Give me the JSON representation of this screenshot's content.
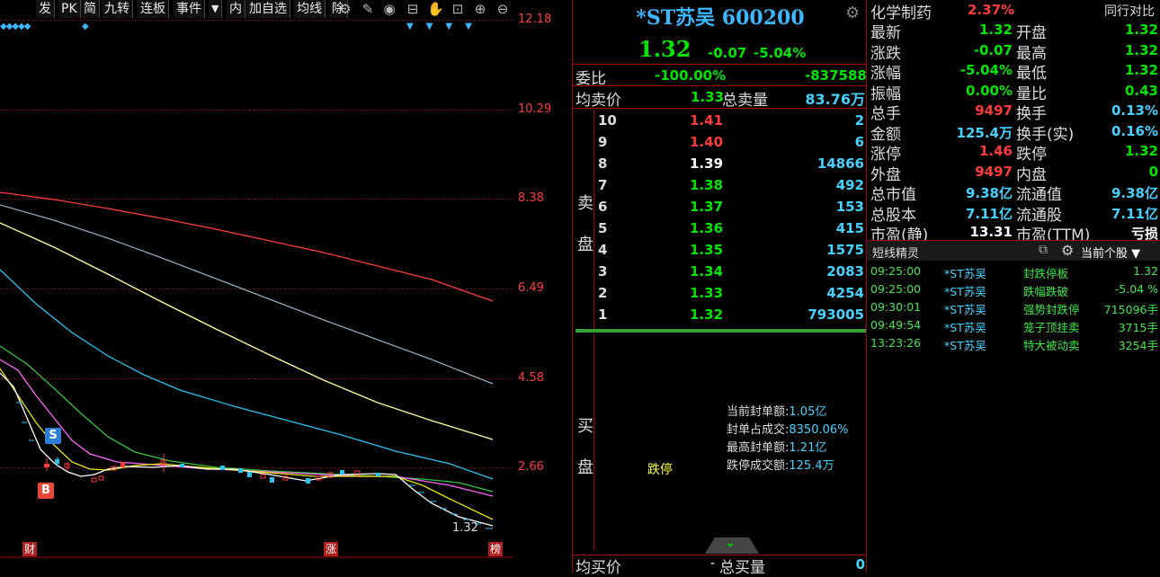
{
  "toolbar": {
    "items": [
      "发",
      "PK",
      "简",
      "九转",
      "连板",
      "事件",
      "▼",
      "内",
      "加自选",
      "均线",
      "除权"
    ]
  },
  "chart": {
    "y_axis": [
      "12.18",
      "10.29",
      "8.38",
      "6.49",
      "4.58",
      "2.66"
    ],
    "last_price_tag": "1.32",
    "markers": {
      "s": "S",
      "b": "B",
      "cai": "财",
      "zhang": "涨",
      "bang": "榜"
    },
    "colors": {
      "ma1": "#ff3b3b",
      "ma2": "#8fa6b8",
      "ma3": "#ffffa0",
      "ma4": "#27c4f0",
      "ma5": "#33c43f",
      "ma6": "#ff66ff",
      "ma7": "#ffffff",
      "ma8": "#e8e800"
    }
  },
  "quote": {
    "name": "*ST苏吴",
    "code": "600200",
    "price": "1.32",
    "change": "-0.07",
    "change_pct": "-5.04%",
    "weibi_label": "委比",
    "weibi_pct": "-100.00%",
    "weibi_diff": "-837588",
    "avg_sell_label": "均卖价",
    "avg_sell": "1.33",
    "total_sell_label": "总卖量",
    "total_sell": "83.76万",
    "sell_side_label": [
      "卖",
      "盘"
    ],
    "sells": [
      {
        "lvl": "10",
        "price": "1.41",
        "vol": "2"
      },
      {
        "lvl": "9",
        "price": "1.40",
        "vol": "6"
      },
      {
        "lvl": "8",
        "price": "1.39",
        "vol": "14866"
      },
      {
        "lvl": "7",
        "price": "1.38",
        "vol": "492"
      },
      {
        "lvl": "6",
        "price": "1.37",
        "vol": "153"
      },
      {
        "lvl": "5",
        "price": "1.36",
        "vol": "415"
      },
      {
        "lvl": "4",
        "price": "1.35",
        "vol": "1575"
      },
      {
        "lvl": "3",
        "price": "1.34",
        "vol": "2083"
      },
      {
        "lvl": "2",
        "price": "1.33",
        "vol": "4254"
      },
      {
        "lvl": "1",
        "price": "1.32",
        "vol": "793005"
      }
    ],
    "buy_side_label": [
      "买",
      "盘"
    ],
    "limit_down_text": "跌停",
    "seal": {
      "current_label": "当前封单额:",
      "current": "1.05亿",
      "ratio_label": "封单占成交:",
      "ratio": "8350.06%",
      "max_label": "最高封单额:",
      "max": "1.21亿",
      "limit_turnover_label": "跌停成交额:",
      "limit_turnover": "125.4万"
    },
    "avg_buy_label": "均买价",
    "avg_buy": "-",
    "total_buy_label": "总买量",
    "total_buy": "0"
  },
  "stats": {
    "industry": "化学制药",
    "industry_pct": "2.37%",
    "peer_label": "同行对比",
    "rows": [
      {
        "l1": "最新",
        "v1": "1.32",
        "l2": "开盘",
        "v2": "1.32"
      },
      {
        "l1": "涨跌",
        "v1": "-0.07",
        "l2": "最高",
        "v2": "1.32"
      },
      {
        "l1": "涨幅",
        "v1": "-5.04%",
        "l2": "最低",
        "v2": "1.32"
      },
      {
        "l1": "振幅",
        "v1": "0.00%",
        "l2": "量比",
        "v2": "0.43"
      },
      {
        "l1": "总手",
        "v1": "9497",
        "l2": "换手",
        "v2": "0.13%"
      },
      {
        "l1": "金额",
        "v1": "125.4万",
        "l2": "换手(实)",
        "v2": "0.16%"
      },
      {
        "l1": "涨停",
        "v1": "1.46",
        "l2": "跌停",
        "v2": "1.32"
      },
      {
        "l1": "外盘",
        "v1": "9497",
        "l2": "内盘",
        "v2": "0"
      },
      {
        "l1": "总市值",
        "v1": "9.38亿",
        "l2": "流通值",
        "v2": "9.38亿"
      },
      {
        "l1": "总股本",
        "v1": "7.11亿",
        "l2": "流通股",
        "v2": "7.11亿"
      },
      {
        "l1": "市盈(静)",
        "v1": "13.31",
        "l2": "市盈(TTM)",
        "v2": "亏损"
      }
    ]
  },
  "news": {
    "title": "短线精灵",
    "scope": "当前个股",
    "items": [
      {
        "time": "09:25:00",
        "stock": "*ST苏吴",
        "event": "封跌停板",
        "value": "1.32"
      },
      {
        "time": "09:25:00",
        "stock": "*ST苏吴",
        "event": "跌幅跌破",
        "value": "-5.04 %"
      },
      {
        "time": "09:30:01",
        "stock": "*ST苏吴",
        "event": "强势封跌停",
        "value": "715096手"
      },
      {
        "time": "09:49:54",
        "stock": "*ST苏吴",
        "event": "笼子顶挂卖",
        "value": "3715手"
      },
      {
        "time": "13:23:26",
        "stock": "*ST苏吴",
        "event": "特大被动卖",
        "value": "3254手"
      }
    ]
  }
}
